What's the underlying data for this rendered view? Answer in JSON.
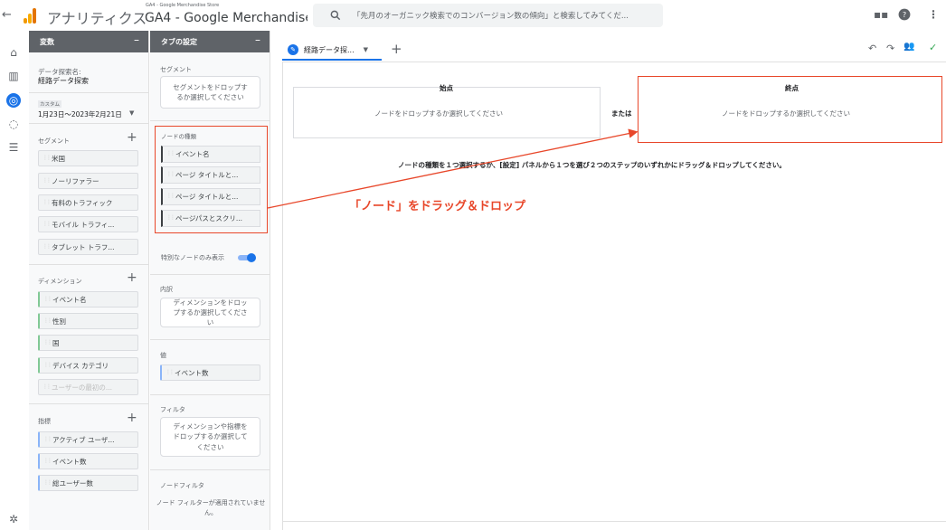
{
  "topbar": {
    "back_icon": "arrow-back-icon",
    "app_name": "アナリティクス",
    "account_small": "GA4 - Google Merchandise Store",
    "account_big": "GA4 - Google Merchandise ...",
    "search_placeholder": "「先月のオーガニック検索でのコンバージョン数の傾向」と検索してみてくだ..."
  },
  "variables": {
    "header": "変数",
    "explore_name_label": "データ探索名:",
    "explore_name": "経路データ探索",
    "date_badge": "カスタム",
    "date_range": "1月23日～2023年2月21日",
    "segments_label": "セグメント",
    "segments": [
      "米国",
      "ノーリファラー",
      "有料のトラフィック",
      "モバイル トラフィ...",
      "タブレット トラフ..."
    ],
    "dimensions_label": "ディメンション",
    "dimensions": [
      "イベント名",
      "性別",
      "国",
      "デバイス カテゴリ",
      "ユーザーの最初の..."
    ],
    "metrics_label": "指標",
    "metrics": [
      "アクティブ ユーザ...",
      "イベント数",
      "総ユーザー数"
    ]
  },
  "tab_settings": {
    "header": "タブの設定",
    "segment_label": "セグメント",
    "segment_drop": "セグメントをドロップするか選択してください",
    "node_type_label": "ノードの種類",
    "node_types": [
      "イベント名",
      "ページ タイトルと...",
      "ページ タイトルと...",
      "ページパスとスクリ..."
    ],
    "special_nodes_label": "特別なノードのみ表示",
    "breakdown_label": "内訳",
    "breakdown_drop": "ディメンションをドロップするか選択してください",
    "value_label": "値",
    "value_chip": "イベント数",
    "filter_label": "フィルタ",
    "filter_drop": "ディメンションや指標をドロップするか選択してください",
    "node_filter_label": "ノードフィルタ",
    "node_filter_text": "ノード フィルターが適用されていません。"
  },
  "canvas": {
    "tab_name": "経路データ探...",
    "start_label": "始点",
    "start_drop": "ノードをドロップするか選択してください",
    "or_label": "または",
    "end_label": "終点",
    "end_drop": "ノードをドロップするか選択してください",
    "hint": "ノードの種類を１つ選択するか、[設定] パネルから１つを選び２つのステップのいずれかにドラッグ＆ドロップしてください。",
    "annotation": "「ノード」をドラッグ＆ドロップ"
  },
  "colors": {
    "accent": "#1a73e8",
    "annotation_red": "#e8472a",
    "toggle_on": "#1a73e8"
  }
}
